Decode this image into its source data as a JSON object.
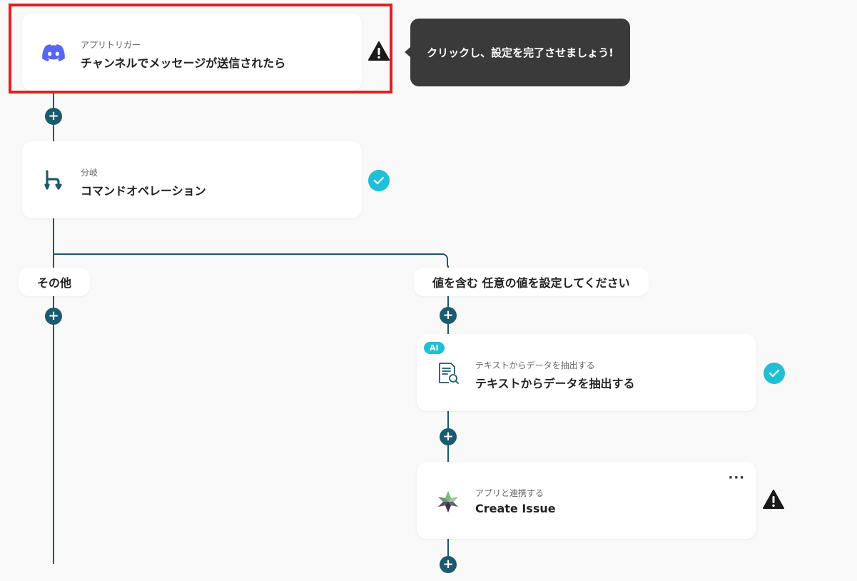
{
  "trigger": {
    "subtitle": "アプリトリガー",
    "title": "チャンネルでメッセージが送信されたら",
    "icon": "discord-icon",
    "status": "warning-icon"
  },
  "tooltip": {
    "text": "クリックし、設定を完了させましょう!"
  },
  "branch": {
    "subtitle": "分岐",
    "title": "コマンドオペレーション",
    "icon": "branch-icon",
    "status": "check-icon"
  },
  "branches": {
    "left_label": "その他",
    "right_label": "値を含む 任意の値を設定してください"
  },
  "extract": {
    "badge": "AI",
    "subtitle": "テキストからデータを抽出する",
    "title": "テキストからデータを抽出する",
    "icon": "document-search-icon",
    "status": "check-icon"
  },
  "issue": {
    "subtitle": "アプリと連携する",
    "title": "Create Issue",
    "icon": "app-logo-icon",
    "menu": "···",
    "status": "warning-icon"
  },
  "colors": {
    "line": "#1c5a6e",
    "check": "#1fc0d6",
    "highlight": "#e02020",
    "discord": "#5865f2",
    "tooltip_bg": "#3a3a3a"
  }
}
